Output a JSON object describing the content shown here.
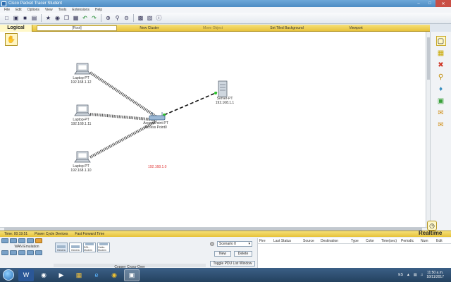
{
  "window": {
    "title": "Cisco Packet Tracer Student"
  },
  "menu": [
    "File",
    "Edit",
    "Options",
    "View",
    "Tools",
    "Extensions",
    "Help"
  ],
  "toolbar": [
    "new-icon",
    "open-icon",
    "save-icon",
    "print-icon",
    "wizard-icon",
    "network-icon",
    "copy-icon",
    "paste-icon",
    "undo-icon",
    "redo-icon",
    "zoom-in-icon",
    "zoom-icon",
    "zoom-out-icon",
    "palette-icon",
    "custom-device-icon",
    "info-icon"
  ],
  "nav": {
    "logical": "Logical",
    "root": "[Root]",
    "new_cluster": "New Cluster",
    "move_object": "Move Object",
    "set_tiled_background": "Set Tiled Background",
    "viewport": "Viewport"
  },
  "devices": {
    "laptop1": {
      "name": "Laptop-PT",
      "ip": "192.168.1.12"
    },
    "laptop2": {
      "name": "Laptop-PT",
      "ip": "192.168.1.11"
    },
    "laptop3": {
      "name": "Laptop-PT",
      "ip": "192.168.1.10"
    },
    "access_point": {
      "name": "AccessPoint-PT",
      "label": "Access Point0"
    },
    "server": {
      "name": "Server-PT",
      "ip": "192.168.1.1"
    }
  },
  "network_label": "192.168.1.0",
  "status": {
    "time": "Time: 00:19:51",
    "power_cycle": "Power Cycle Devices",
    "fast_forward": "Fast Forward Time",
    "mode": "Realtime"
  },
  "bottom": {
    "category_label": "WAN Emulation",
    "device_types": [
      "Generic",
      "Generic",
      "DSL-Modem",
      "Cable-Modem"
    ],
    "connection_label": "Copper Cross-Over",
    "scenario": "Scenario 0",
    "new_btn": "New",
    "delete_btn": "Delete",
    "toggle_btn": "Toggle PDU List Window",
    "pdu_columns": [
      "Fire",
      "Last Status",
      "Source",
      "Destination",
      "Type",
      "Color",
      "Time(sec)",
      "Periodic",
      "Num",
      "Edit"
    ]
  },
  "taskbar": {
    "language": "ES",
    "time": "11:50 a.m.",
    "date": "18/11/2017"
  }
}
